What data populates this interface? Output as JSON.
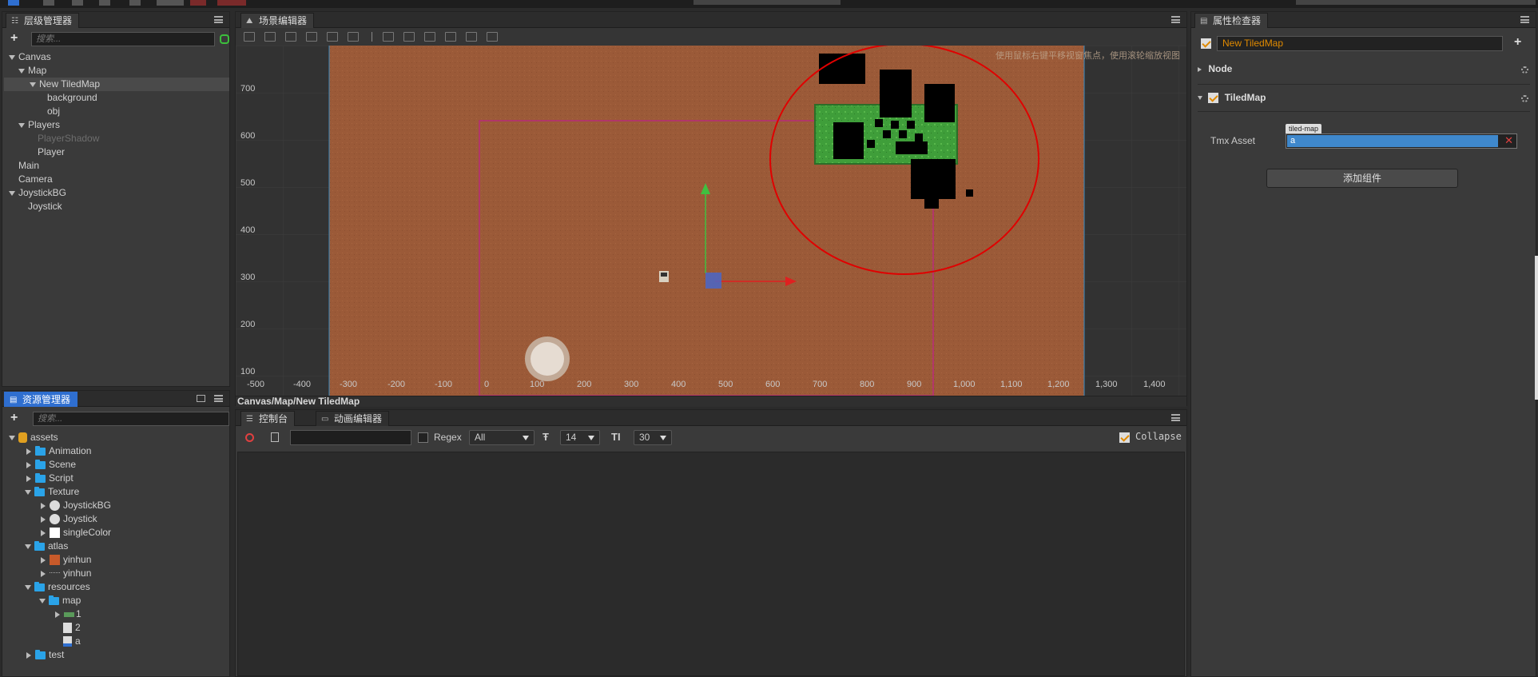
{
  "hierarchy": {
    "tab_label": "层级管理器",
    "search_placeholder": "搜索...",
    "nodes": [
      {
        "label": "Canvas"
      },
      {
        "label": "Map"
      },
      {
        "label": "New TiledMap"
      },
      {
        "label": "background"
      },
      {
        "label": "obj"
      },
      {
        "label": "Players"
      },
      {
        "label": "PlayerShadow"
      },
      {
        "label": "Player"
      },
      {
        "label": "Main"
      },
      {
        "label": "Camera"
      },
      {
        "label": "JoystickBG"
      },
      {
        "label": "Joystick"
      }
    ]
  },
  "assets": {
    "tab_label": "资源管理器",
    "search_placeholder": "搜索...",
    "items": [
      {
        "label": "assets"
      },
      {
        "label": "Animation"
      },
      {
        "label": "Scene"
      },
      {
        "label": "Script"
      },
      {
        "label": "Texture"
      },
      {
        "label": "JoystickBG"
      },
      {
        "label": "Joystick"
      },
      {
        "label": "singleColor"
      },
      {
        "label": "atlas"
      },
      {
        "label": "yinhun"
      },
      {
        "label": "yinhun"
      },
      {
        "label": "resources"
      },
      {
        "label": "map"
      },
      {
        "label": "1"
      },
      {
        "label": "2"
      },
      {
        "label": "a"
      },
      {
        "label": "test"
      }
    ]
  },
  "scene": {
    "tab_label": "场景编辑器",
    "hint": "使用鼠标右键平移视窗焦点，使用滚轮缩放视图",
    "breadcrumb": "Canvas/Map/New TiledMap",
    "y_ticks": [
      "700",
      "600",
      "500",
      "400",
      "300",
      "200",
      "100"
    ],
    "x_ticks": [
      "-500",
      "-400",
      "-300",
      "-200",
      "-100",
      "0",
      "100",
      "200",
      "300",
      "400",
      "500",
      "600",
      "700",
      "800",
      "900",
      "1,000",
      "1,100",
      "1,200",
      "1,300",
      "1,400"
    ]
  },
  "console": {
    "tab_console": "控制台",
    "tab_animation": "动画编辑器",
    "regex_label": "Regex",
    "filter_value": "All",
    "font_size_value": "14",
    "line_height_value": "30",
    "collapse_label": "Collapse"
  },
  "inspector": {
    "tab_label": "属性检查器",
    "node_name": "New TiledMap",
    "node_section": "Node",
    "component_name": "TiledMap",
    "tmx_label": "Tmx Asset",
    "tmx_tag": "tiled-map",
    "tmx_value": "a",
    "add_component": "添加组件"
  },
  "colors": {
    "accent_blue": "#2f6fd0",
    "orange_text": "#e08a00",
    "map_ground": "#9b5a38",
    "selection_magenta": "#c0208a"
  }
}
